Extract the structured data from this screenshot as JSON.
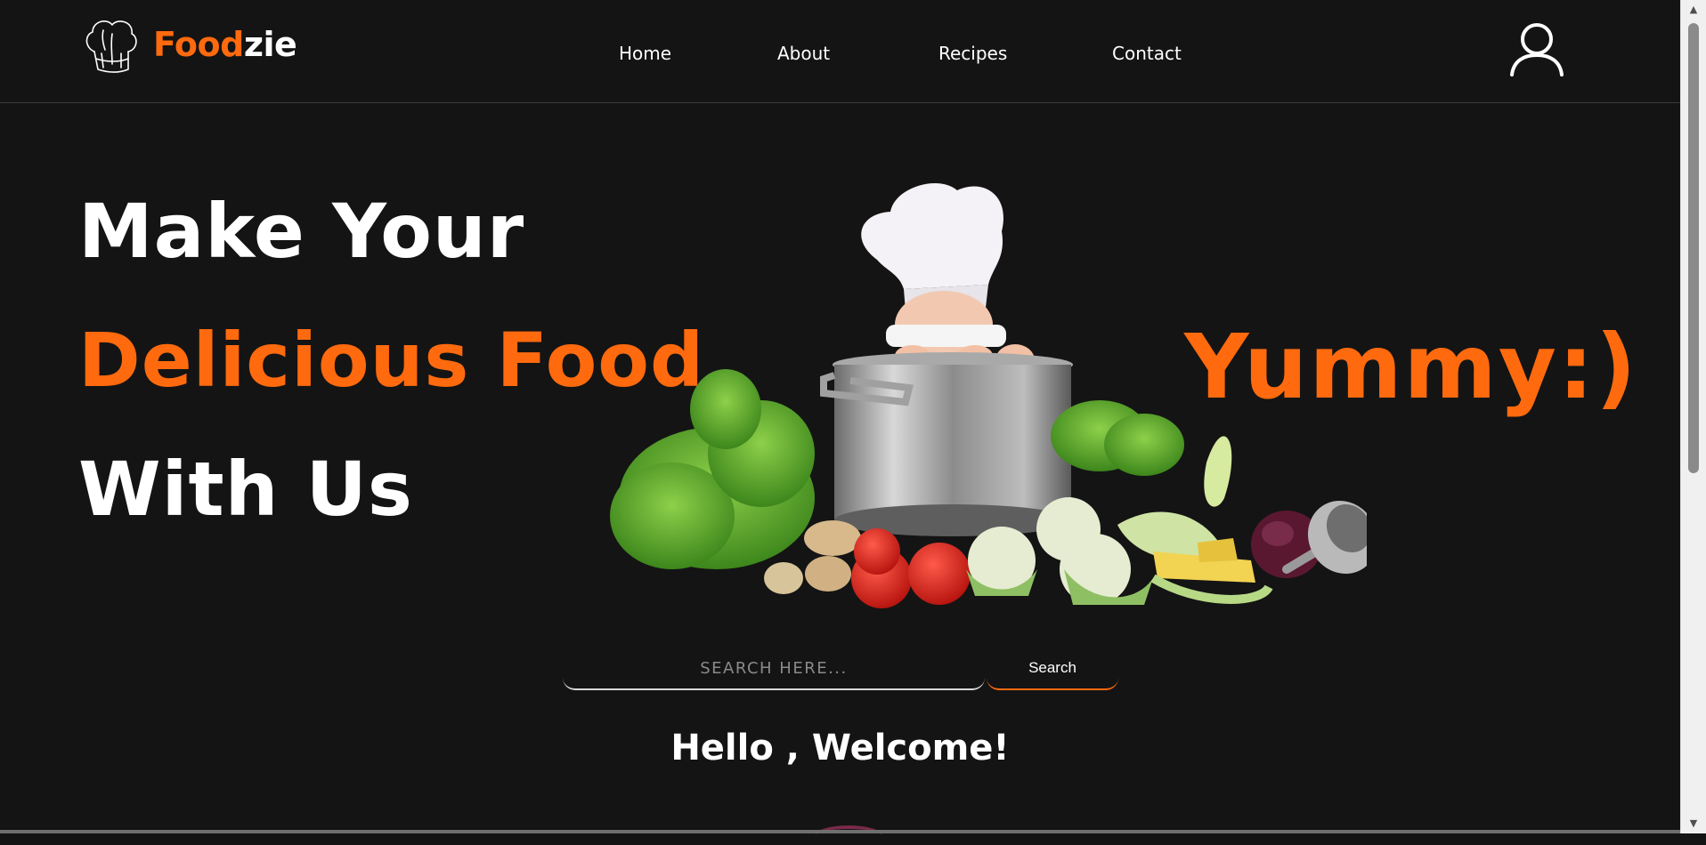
{
  "brand": {
    "part1": "Food",
    "part2": "zie"
  },
  "nav": {
    "items": [
      "Home",
      "About",
      "Recipes",
      "Contact"
    ]
  },
  "hero": {
    "line1": "Make Your",
    "line2": "Delicious Food",
    "line3": "With Us",
    "tagline": "Yummy:)"
  },
  "search": {
    "placeholder": "SEARCH HERE...",
    "button_label": "Search"
  },
  "welcome": "Hello , Welcome!",
  "colors": {
    "accent": "#ff6a0e",
    "background": "#141414",
    "text": "#ffffff"
  }
}
